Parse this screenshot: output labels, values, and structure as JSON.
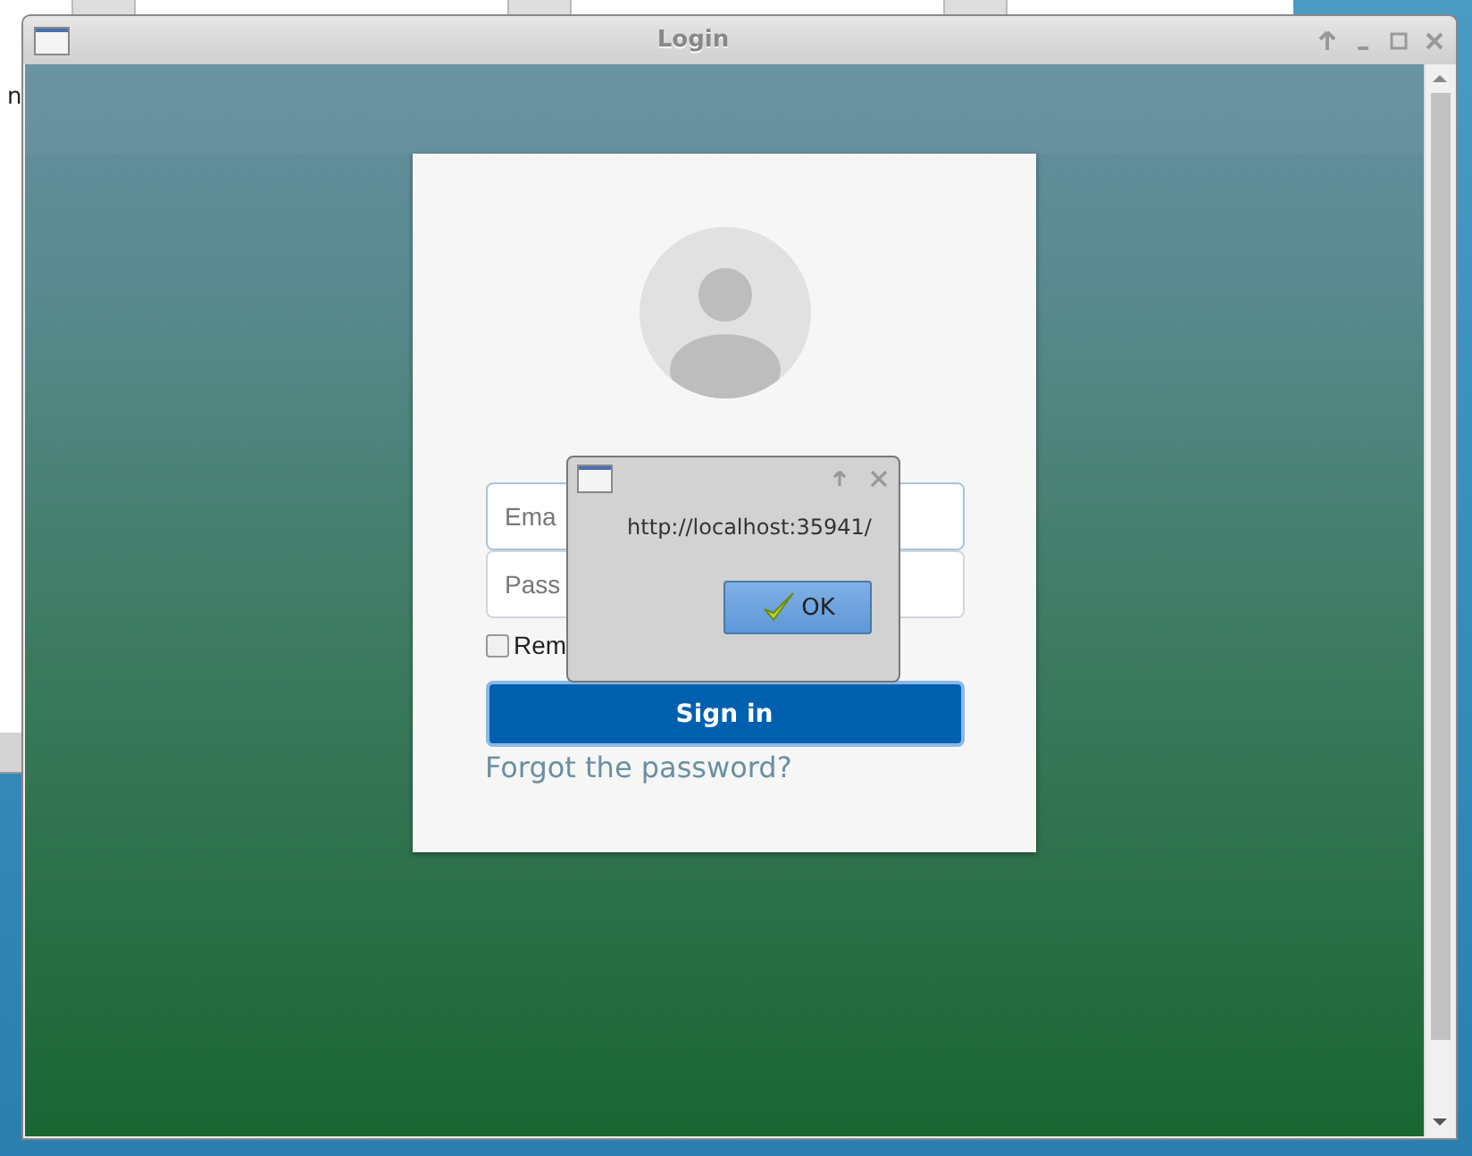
{
  "background_window": {
    "text": "n"
  },
  "window": {
    "title": "Login"
  },
  "login_form": {
    "email": {
      "placeholder": "Ema"
    },
    "password": {
      "placeholder": "Pass"
    },
    "remember": {
      "label": "Rem",
      "checked": false
    },
    "submit": "Sign in",
    "forgot_link": "Forgot the password?"
  },
  "dialog": {
    "message": "http://localhost:35941/",
    "button": "OK"
  }
}
